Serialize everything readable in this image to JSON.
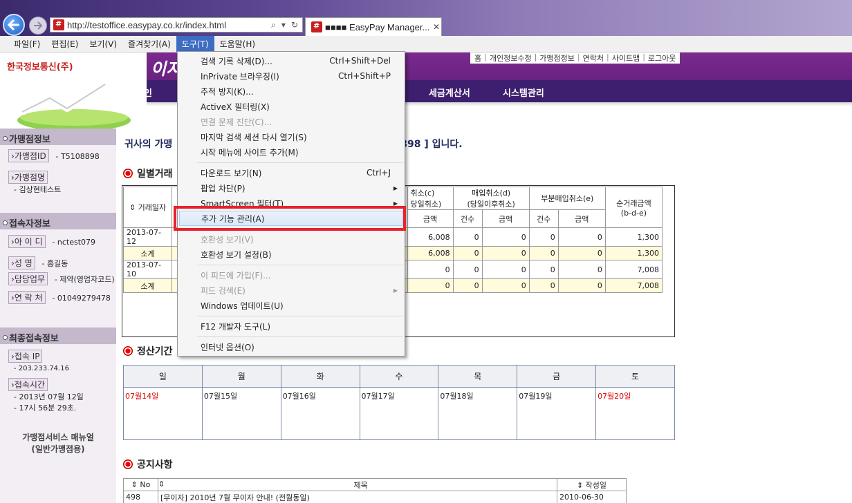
{
  "browser": {
    "address": "http://testoffice.easypay.co.kr/index.html",
    "tab_title": "■■■■ EasyPay Manager...",
    "menus": [
      "파일(F)",
      "편집(E)",
      "보기(V)",
      "즐겨찾기(A)",
      "도구(T)",
      "도움말(H)"
    ],
    "open_menu_index": 4
  },
  "site": {
    "logo_text": "한국정보통신(주)",
    "brand_title": "이지",
    "top_links": [
      "홈",
      "개인정보수정",
      "가맹점정보",
      "연락처",
      "사이트맵",
      "로그아웃"
    ],
    "nav": [
      "승인",
      "세금계산서",
      "시스템관리"
    ]
  },
  "sidebar": {
    "merchant_head": "가맹점정보",
    "merchant_id_label": "가맹점ID",
    "merchant_id": "- T5108898",
    "merchant_name_label": "가맹점명",
    "merchant_name": "- 김상현테스트",
    "user_head": "접속자정보",
    "user_id_label": "아 이 디",
    "user_id": "- nctest079",
    "user_name_label": "성  명",
    "user_name": "- 홍길동",
    "duty_label": "담당업무",
    "duty": "- 제약(영업자코드)",
    "phone_label": "연 락 처",
    "phone": "- 01049279478",
    "last_head": "최종접속정보",
    "ip_label": "접속 IP",
    "ip": "- 203.233.74.16",
    "time_label": "접속시간",
    "time_date": "- 2013년 07월 12일",
    "time_clock": "- 17시 56분 29초.",
    "manual_line1": "가맹점서비스 매뉴얼",
    "manual_line2": "(일반가맹점용)"
  },
  "main": {
    "welcome_prefix": "귀사의 가맹",
    "welcome_suffix": "898 ] 입니다.",
    "daily_title": "일별거래",
    "daily_headers": {
      "date": "거래일자",
      "cancel_c_line1": "취소(c)",
      "cancel_c_line2": "당일취소)",
      "purchase_cancel_line1": "매입취소(d)",
      "purchase_cancel_line2": "(당일이후취소)",
      "partial_cancel": "부분매입취소(e)",
      "net_line1": "순거래금액",
      "net_line2": "(b-d-e)",
      "amount": "금액",
      "count": "건수"
    },
    "daily_rows": [
      {
        "date": "2013-07-12",
        "c_amt": "6,008",
        "d_cnt": "0",
        "d_amt": "0",
        "e_cnt": "0",
        "e_amt": "0",
        "net": "1,300",
        "subtotal": false
      },
      {
        "date": "소계",
        "c_amt": "6,008",
        "d_cnt": "0",
        "d_amt": "0",
        "e_cnt": "0",
        "e_amt": "0",
        "net": "1,300",
        "subtotal": true
      },
      {
        "date": "2013-07-10",
        "c_amt": "0",
        "d_cnt": "0",
        "d_amt": "0",
        "e_cnt": "0",
        "e_amt": "0",
        "net": "7,008",
        "subtotal": false
      },
      {
        "date": "소계",
        "c_amt": "0",
        "d_cnt": "0",
        "d_amt": "0",
        "e_cnt": "0",
        "e_amt": "0",
        "net": "7,008",
        "subtotal": true
      }
    ],
    "settle_title": "정산기간",
    "cal_days": [
      "일",
      "월",
      "화",
      "수",
      "목",
      "금",
      "토"
    ],
    "cal_dates": [
      "07월14일",
      "07월15일",
      "07월16일",
      "07월17일",
      "07월18일",
      "07월19일",
      "07월20일"
    ],
    "notice_title": "공지사항",
    "notice_headers": {
      "no": "No",
      "subject": "제목",
      "date": "작성일"
    },
    "notice_rows": [
      {
        "no": "498",
        "subject": "[무이자] 2010년 7월 무이자 안내! (전월동일)",
        "date": "2010-06-30"
      }
    ]
  },
  "tools_menu": {
    "items": [
      {
        "label": "검색 기록 삭제(D)...",
        "shortcut": "Ctrl+Shift+Del",
        "disabled": false
      },
      {
        "label": "InPrivate 브라우징(I)",
        "shortcut": "Ctrl+Shift+P",
        "disabled": false
      },
      {
        "label": "추적 방지(K)...",
        "shortcut": "",
        "disabled": false
      },
      {
        "label": "ActiveX 필터링(X)",
        "shortcut": "",
        "disabled": false
      },
      {
        "label": "연결 문제 진단(C)...",
        "shortcut": "",
        "disabled": true
      },
      {
        "label": "마지막 검색 세션 다시 열기(S)",
        "shortcut": "",
        "disabled": false
      },
      {
        "label": "시작 메뉴에 사이트 추가(M)",
        "shortcut": "",
        "disabled": false
      },
      {
        "label": "다운로드 보기(N)",
        "shortcut": "Ctrl+J",
        "disabled": false
      },
      {
        "label": "팝업 차단(P)",
        "shortcut": "",
        "disabled": false
      },
      {
        "label": "SmartScreen 필터(T)",
        "shortcut": "",
        "disabled": false
      },
      {
        "label": "추가 기능 관리(A)",
        "shortcut": "",
        "disabled": false
      },
      {
        "label": "호환성 보기(V)",
        "shortcut": "",
        "disabled": true
      },
      {
        "label": "호환성 보기 설정(B)",
        "shortcut": "",
        "disabled": false
      },
      {
        "label": "이 피드에 가입(F)...",
        "shortcut": "",
        "disabled": true
      },
      {
        "label": "피드 검색(E)",
        "shortcut": "",
        "disabled": true
      },
      {
        "label": "Windows 업데이트(U)",
        "shortcut": "",
        "disabled": false
      },
      {
        "label": "F12 개발자 도구(L)",
        "shortcut": "",
        "disabled": false
      },
      {
        "label": "인터넷 옵션(O)",
        "shortcut": "",
        "disabled": false
      }
    ],
    "highlight_color": "#e8212b"
  }
}
